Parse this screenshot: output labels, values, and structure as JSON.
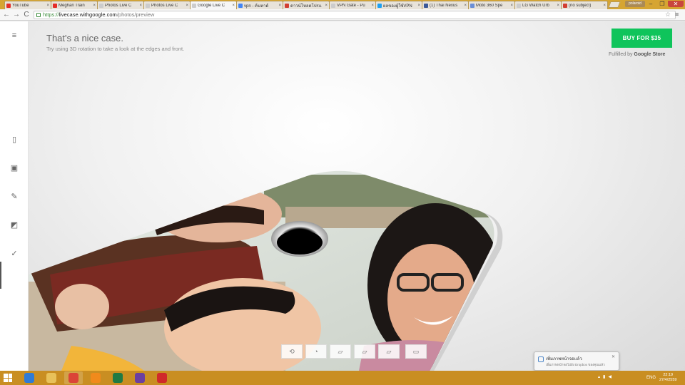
{
  "browser": {
    "tabs": [
      {
        "title": "YouTube",
        "fav": "#e52d27",
        "active": false
      },
      {
        "title": "Meghan Train",
        "fav": "#e52d27",
        "active": false
      },
      {
        "title": "Photos Live C",
        "fav": "#cccccc",
        "active": false
      },
      {
        "title": "Photos Live C",
        "fav": "#cccccc",
        "active": false
      },
      {
        "title": "Google Live C",
        "fav": "#cccccc",
        "active": true
      },
      {
        "title": "vpn - ค้นหาด้",
        "fav": "#4285f4",
        "active": false
      },
      {
        "title": "ดาวน์โหลดโปรแ",
        "fav": "#d23f31",
        "active": false
      },
      {
        "title": "VPN Gate - Pu",
        "fav": "#cccccc",
        "active": false
      },
      {
        "title": "ผลของผู้ใช้VPN",
        "fav": "#1da1f2",
        "active": false
      },
      {
        "title": "(1) Thai Nexus",
        "fav": "#3b5998",
        "active": false
      },
      {
        "title": "Moto 360 Spe",
        "fav": "#6b8fd6",
        "active": false
      },
      {
        "title": "LG Watch Urb",
        "fav": "#cccccc",
        "active": false
      },
      {
        "title": "(no subject)",
        "fav": "#d23f31",
        "active": false
      }
    ],
    "tab_close": "×",
    "window_badge": "polaroid",
    "win_min": "–",
    "win_max": "❐",
    "win_close": "✕",
    "back": "←",
    "forward": "→",
    "reload": "C",
    "url_scheme": "https://",
    "url_host": "livecase.withgoogle.com",
    "url_path": "/photos/preview",
    "star": "☆",
    "menu": "≡"
  },
  "rail": {
    "menu_icon": "≡",
    "items": [
      {
        "name": "rail-phone",
        "glyph": "▯"
      },
      {
        "name": "rail-photo",
        "glyph": "▣"
      },
      {
        "name": "rail-edit",
        "glyph": "✎"
      },
      {
        "name": "rail-layout",
        "glyph": "◩"
      },
      {
        "name": "rail-check",
        "glyph": "✓"
      }
    ]
  },
  "page": {
    "headline": "That's a nice case.",
    "subline": "Try using 3D rotation to take a look at the edges and front.",
    "buy_label": "BUY FOR  $35",
    "fulfilled_prefix": "Fulfilled by",
    "fulfilled_brand": "Google Store"
  },
  "rotation": [
    {
      "name": "rotate-3d-button",
      "glyph": "⟲"
    },
    {
      "name": "view-back-button",
      "glyph": "◔"
    },
    {
      "name": "view-side-right-button",
      "glyph": "▱"
    },
    {
      "name": "view-side-left-button",
      "glyph": "▱"
    },
    {
      "name": "view-edge-button",
      "glyph": "▱"
    },
    {
      "name": "view-front-button",
      "glyph": "▭"
    }
  ],
  "toast": {
    "title": "เพิ่มภาพหน้าจอแล้ว",
    "body": "เพิ่มภาพหน้าจอไปยัง Dropbox ของคุณแล้ว",
    "close": "✕"
  },
  "taskbar": {
    "apps": [
      {
        "name": "ie-app",
        "color": "#2f7bd6",
        "running": false
      },
      {
        "name": "explorer-app",
        "color": "#e8c15a",
        "running": false
      },
      {
        "name": "chrome-app",
        "color": "#db4437",
        "running": true
      },
      {
        "name": "vlc-app",
        "color": "#f08a1c",
        "running": false
      },
      {
        "name": "excel-app",
        "color": "#1f7a44",
        "running": false
      },
      {
        "name": "vs-app",
        "color": "#6b3fa0",
        "running": false
      },
      {
        "name": "opera-app",
        "color": "#d02a2a",
        "running": false
      }
    ],
    "language": "ENG",
    "time": "22:19",
    "date": "27/4/2559"
  }
}
